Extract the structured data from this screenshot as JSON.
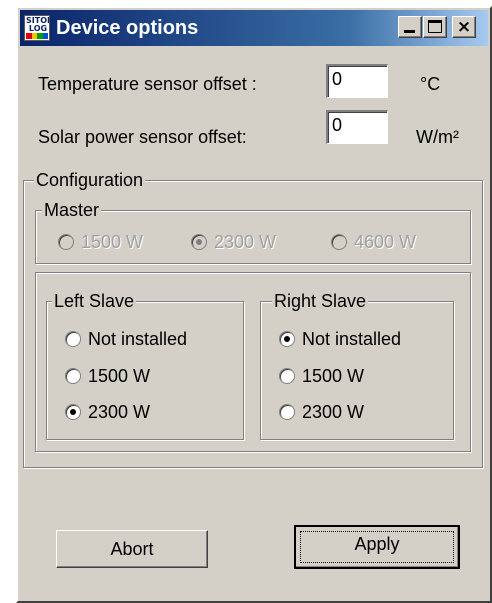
{
  "window": {
    "title": "Device options",
    "icon_text": [
      "SITOP",
      "LOG"
    ],
    "icon_stripe_colors": [
      "#e00000",
      "#f0c000",
      "#00a000",
      "#0050d0"
    ],
    "controls": {
      "minimize": "minimize-icon",
      "maximize": "maximize-icon",
      "close": "×"
    }
  },
  "settings": {
    "temperature_label": "Temperature sensor offset :",
    "temperature_value": "0",
    "temperature_unit": "°C",
    "solar_label": "Solar power sensor offset:",
    "solar_value": "0",
    "solar_unit": "W/m²"
  },
  "configuration": {
    "label": "Configuration",
    "master": {
      "label": "Master",
      "enabled": false,
      "options": [
        "1500 W",
        "2300 W",
        "4600 W"
      ],
      "selected": "2300 W"
    },
    "left_slave": {
      "label": "Left Slave",
      "options": [
        "Not installed",
        "1500 W",
        "2300 W"
      ],
      "selected": "2300 W"
    },
    "right_slave": {
      "label": "Right Slave",
      "options": [
        "Not installed",
        "1500 W",
        "2300 W"
      ],
      "selected": "Not installed"
    }
  },
  "buttons": {
    "abort": "Abort",
    "apply": "Apply"
  }
}
